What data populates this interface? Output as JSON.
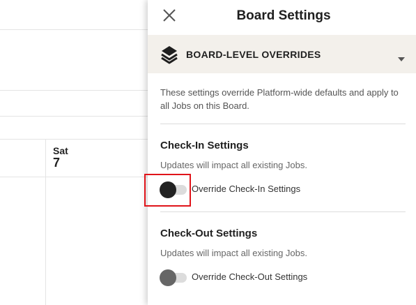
{
  "calendar": {
    "day_name": "Sat",
    "day_number": "7"
  },
  "drawer": {
    "title": "Board Settings",
    "close_icon": "close-icon",
    "section": {
      "label": "BOARD-LEVEL OVERRIDES",
      "icon": "layers-icon",
      "expanded_icon": "caret-down-icon"
    },
    "description": "These settings override Platform-wide defaults and apply to all Jobs on this Board.",
    "checkin": {
      "title": "Check-In Settings",
      "subtitle": "Updates will impact all existing Jobs.",
      "toggle_label": "Override Check-In Settings",
      "toggle_on": false
    },
    "checkout": {
      "title": "Check-Out Settings",
      "subtitle": "Updates will impact all existing Jobs.",
      "toggle_label": "Override Check-Out Settings",
      "toggle_on": false
    }
  },
  "colors": {
    "highlight": "#e0141a",
    "section_bg": "#f3f0eb"
  }
}
